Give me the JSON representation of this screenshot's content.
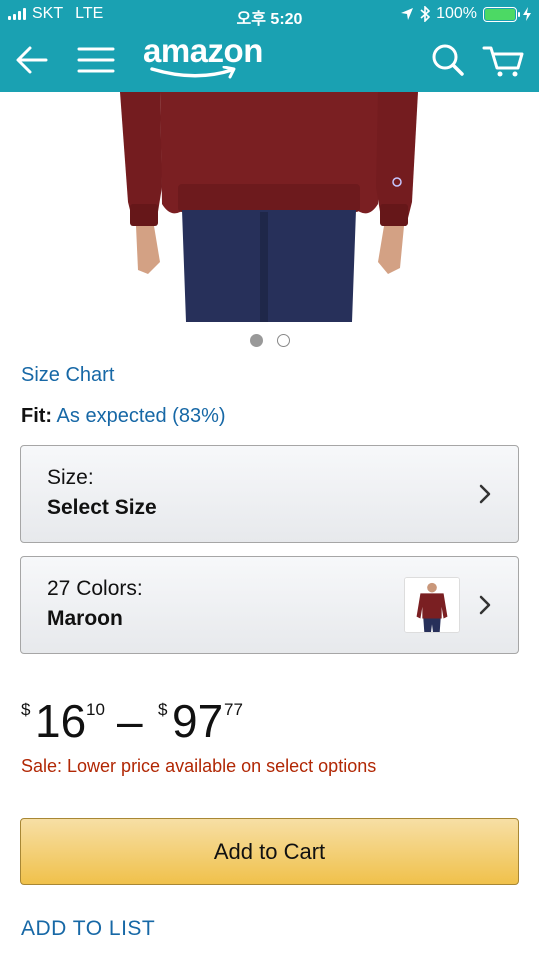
{
  "status_bar": {
    "carrier": "SKT",
    "network": "LTE",
    "time": "오후 5:20",
    "battery": "100%"
  },
  "nav": {
    "logo": "amazon",
    "icons": [
      "back-arrow-icon",
      "menu-icon",
      "search-icon",
      "cart-icon"
    ]
  },
  "carousel": {
    "total": 2,
    "active": 1
  },
  "product": {
    "size_chart": "Size Chart",
    "fit_label": "Fit:",
    "fit_value": "As expected (83%)",
    "size_selector": {
      "label": "Size:",
      "value": "Select Size"
    },
    "color_selector": {
      "label": "27 Colors:",
      "value": "Maroon"
    },
    "price": {
      "low_symbol": "$",
      "low_whole": "16",
      "low_fraction": "10",
      "separator": "–",
      "high_symbol": "$",
      "high_whole": "97",
      "high_fraction": "77"
    },
    "sale_text": "Sale: Lower price available on select options"
  },
  "actions": {
    "add_to_cart": "Add to Cart",
    "add_to_list": "ADD TO LIST"
  },
  "colors": {
    "header_teal": "#1AA1B2",
    "link_blue": "#1768a6",
    "sale_red": "#b12704",
    "cart_button": "#f0c14b",
    "product_maroon": "#7a1f22"
  }
}
